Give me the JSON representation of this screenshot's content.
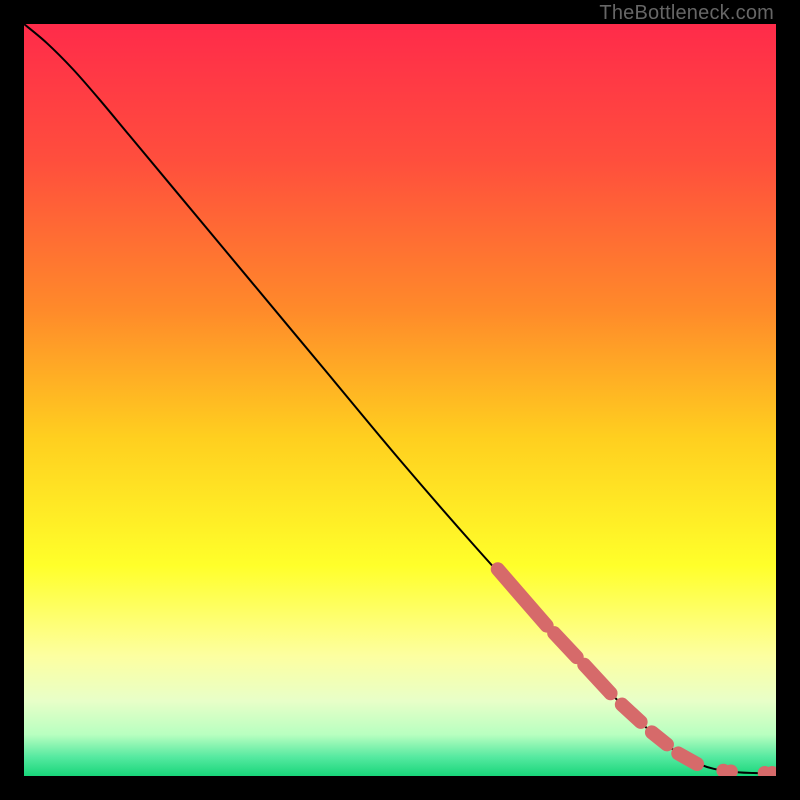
{
  "attribution": "TheBottleneck.com",
  "chart_data": {
    "type": "line",
    "title": "",
    "xlabel": "",
    "ylabel": "",
    "xlim": [
      0,
      100
    ],
    "ylim": [
      0,
      100
    ],
    "gradient_stops": [
      {
        "offset": 0,
        "color": "#ff2b4a"
      },
      {
        "offset": 0.18,
        "color": "#ff4e3d"
      },
      {
        "offset": 0.38,
        "color": "#ff8a2a"
      },
      {
        "offset": 0.55,
        "color": "#ffcf1f"
      },
      {
        "offset": 0.72,
        "color": "#ffff2a"
      },
      {
        "offset": 0.84,
        "color": "#fdffa0"
      },
      {
        "offset": 0.9,
        "color": "#e8ffc8"
      },
      {
        "offset": 0.945,
        "color": "#b8ffc0"
      },
      {
        "offset": 0.975,
        "color": "#55e9a0"
      },
      {
        "offset": 1.0,
        "color": "#18d67a"
      }
    ],
    "curve": [
      {
        "x": 0.0,
        "y": 100.0
      },
      {
        "x": 3.0,
        "y": 97.5
      },
      {
        "x": 6.5,
        "y": 94.0
      },
      {
        "x": 10.0,
        "y": 90.0
      },
      {
        "x": 14.0,
        "y": 85.2
      },
      {
        "x": 20.0,
        "y": 78.0
      },
      {
        "x": 30.0,
        "y": 66.0
      },
      {
        "x": 40.0,
        "y": 54.0
      },
      {
        "x": 50.0,
        "y": 42.0
      },
      {
        "x": 60.0,
        "y": 30.5
      },
      {
        "x": 70.0,
        "y": 19.5
      },
      {
        "x": 78.0,
        "y": 11.0
      },
      {
        "x": 85.0,
        "y": 4.5
      },
      {
        "x": 90.0,
        "y": 1.5
      },
      {
        "x": 94.0,
        "y": 0.6
      },
      {
        "x": 97.0,
        "y": 0.4
      },
      {
        "x": 100.0,
        "y": 0.4
      }
    ],
    "marker_segments": [
      {
        "start": {
          "x": 63.0,
          "y": 27.5
        },
        "end": {
          "x": 69.5,
          "y": 20.0
        }
      },
      {
        "start": {
          "x": 70.5,
          "y": 19.0
        },
        "end": {
          "x": 73.5,
          "y": 15.8
        }
      },
      {
        "start": {
          "x": 74.5,
          "y": 14.8
        },
        "end": {
          "x": 78.0,
          "y": 11.0
        }
      },
      {
        "start": {
          "x": 79.5,
          "y": 9.5
        },
        "end": {
          "x": 82.0,
          "y": 7.2
        }
      },
      {
        "start": {
          "x": 83.5,
          "y": 5.8
        },
        "end": {
          "x": 85.5,
          "y": 4.2
        }
      },
      {
        "start": {
          "x": 87.0,
          "y": 3.0
        },
        "end": {
          "x": 89.5,
          "y": 1.6
        }
      }
    ],
    "marker_dots": [
      {
        "x": 93.0,
        "y": 0.7
      },
      {
        "x": 94.0,
        "y": 0.6
      },
      {
        "x": 98.5,
        "y": 0.4
      },
      {
        "x": 99.5,
        "y": 0.4
      }
    ],
    "marker_color": "#d66a6a",
    "marker_radius": 7
  }
}
